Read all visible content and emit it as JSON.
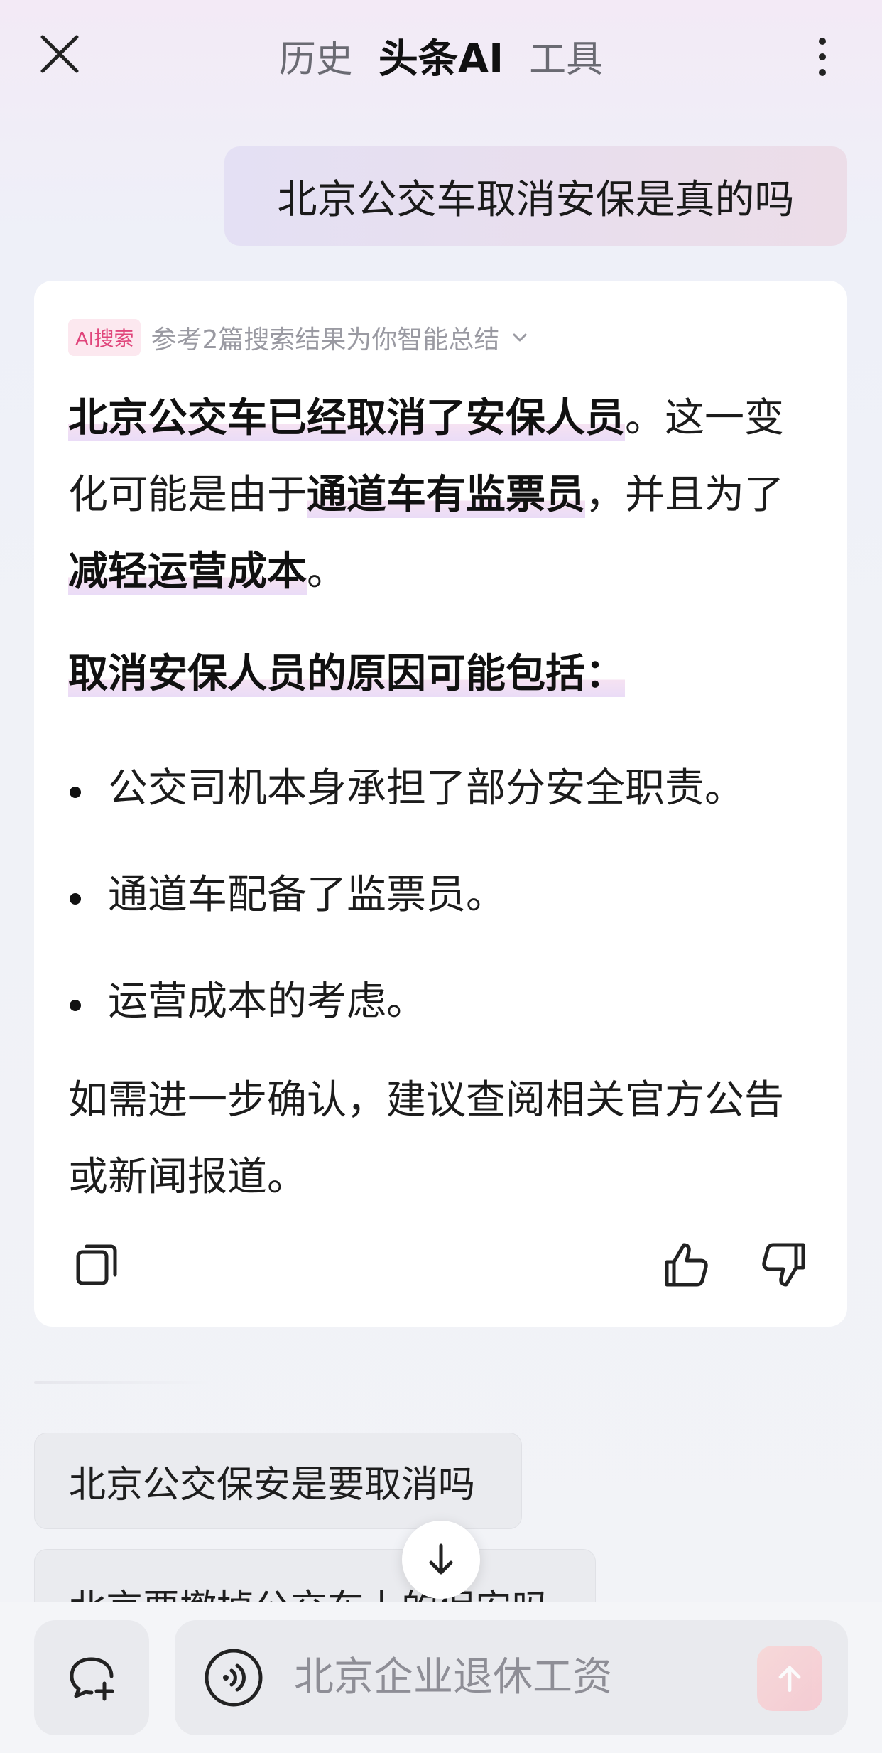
{
  "header": {
    "tabs": [
      "历史",
      "头条AI",
      "工具"
    ],
    "active_tab": "头条AI"
  },
  "user_message": "北京公交车取消安保是真的吗",
  "answer": {
    "badge": "AI搜索",
    "reference_text": "参考2篇搜索结果为你智能总结",
    "p1_segments": [
      {
        "text": "北京公交车已经取消了安保人员",
        "bold": true
      },
      {
        "text": "。这一变化可能是由于",
        "bold": false
      },
      {
        "text": "通道车有监票员",
        "bold": true
      },
      {
        "text": "，并且为了",
        "bold": false
      },
      {
        "text": "减轻运营成本",
        "bold": true
      },
      {
        "text": "。",
        "bold": false
      }
    ],
    "heading": "取消安保人员的原因可能包括：",
    "bullets": [
      "公交司机本身承担了部分安全职责。",
      "通道车配备了监票员。",
      "运营成本的考虑。"
    ],
    "closing": "如需进一步确认，建议查阅相关官方公告或新闻报道。"
  },
  "suggestions": [
    "北京公交保安是要取消吗",
    "北京要撤掉公交车上的保安吗"
  ],
  "input": {
    "placeholder": "北京企业退休工资"
  },
  "icons": {
    "close": "close-icon",
    "more": "more-vertical-icon",
    "copy": "copy-icon",
    "like": "thumbs-up-icon",
    "dislike": "thumbs-down-icon",
    "scroll": "arrow-down-icon",
    "new_chat": "new-chat-icon",
    "voice": "voice-icon",
    "send": "send-arrow-icon"
  },
  "colors": {
    "badge_text": "#e0457b",
    "highlight": "#eadcf7"
  }
}
